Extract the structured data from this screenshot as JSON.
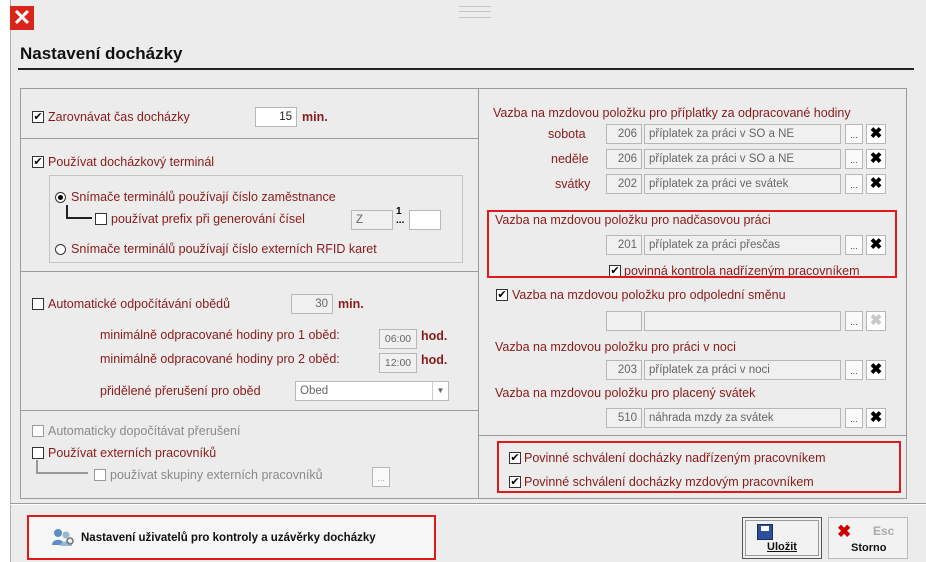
{
  "window": {
    "title": "Nastavení docházky"
  },
  "left": {
    "align": {
      "checked": true,
      "label": "Zarovnávat čas docházky",
      "value": "15",
      "unit": "min."
    },
    "terminal": {
      "checked": true,
      "label": "Používat docházkový terminál",
      "radio1": {
        "selected": true,
        "label": "Snímače terminálů používají číslo zaměstnance"
      },
      "prefix": {
        "checked": false,
        "label": "používat prefix při generování čísel",
        "from": "Z",
        "mark": "1",
        "to": ""
      },
      "radio2": {
        "selected": false,
        "label": "Snímače terminálů používají číslo externích RFID karet"
      }
    },
    "lunch": {
      "checked": false,
      "label": "Automatické odpočítávání obědů",
      "value": "30",
      "unit": "min.",
      "min1_label": "minimálně odpracované hodiny pro 1 oběd:",
      "min1_value": "06:00",
      "min2_label": "minimálně odpracované hodiny pro 2 oběd:",
      "min2_value": "12:00",
      "hod": "hod.",
      "break_label": "přidělené přerušení pro oběd",
      "break_value": "Obed"
    },
    "auto_break": {
      "checked": false,
      "label": "Automaticky dopočítávat přerušení"
    },
    "external": {
      "checked": false,
      "label": "Používat externích pracovníků"
    },
    "ext_groups": {
      "checked": false,
      "label": "používat skupiny externích pracovníků",
      "dots": "..."
    }
  },
  "right": {
    "surcharge_title": "Vazba na mzdovou položku pro příplatky za odpracované hodiny",
    "surcharges": [
      {
        "day": "sobota",
        "code": "206",
        "name": "příplatek za práci v SO a NE"
      },
      {
        "day": "neděle",
        "code": "206",
        "name": "příplatek za práci v SO a NE"
      },
      {
        "day": "svátky",
        "code": "202",
        "name": "příplatek za práci ve svátek"
      }
    ],
    "overtime": {
      "title": "Vazba na mzdovou položku pro nadčasovou práci",
      "code": "201",
      "name": "příplatek za práci přesčas",
      "check_label": "povinná kontrola nadřízeným pracovníkem",
      "checked": true
    },
    "afternoon": {
      "checked": true,
      "label": "Vazba na mzdovou položku pro odpolední směnu",
      "code": "",
      "name": ""
    },
    "night": {
      "title": "Vazba na mzdovou položku pro práci v noci",
      "code": "203",
      "name": "příplatek za práci v noci"
    },
    "holiday": {
      "title": "Vazba na mzdovou položku pro placený svátek",
      "code": "510",
      "name": "náhrada mzdy za svátek"
    },
    "approve_supervisor": {
      "checked": true,
      "label": "Povinné schválení docházky nadřízeným pracovníkem"
    },
    "approve_payroll": {
      "checked": true,
      "label": "Povinné schválení docházky mzdovým pracovníkem"
    }
  },
  "footer": {
    "users_button": "Nastavení uživatelů pro kontroly a uzávěrky docházky",
    "save": "Uložit",
    "cancel": "Storno",
    "esc": "Esc",
    "dots": "..."
  },
  "icons": [
    "close-icon",
    "users-settings-icon",
    "save-icon",
    "cancel-icon"
  ]
}
